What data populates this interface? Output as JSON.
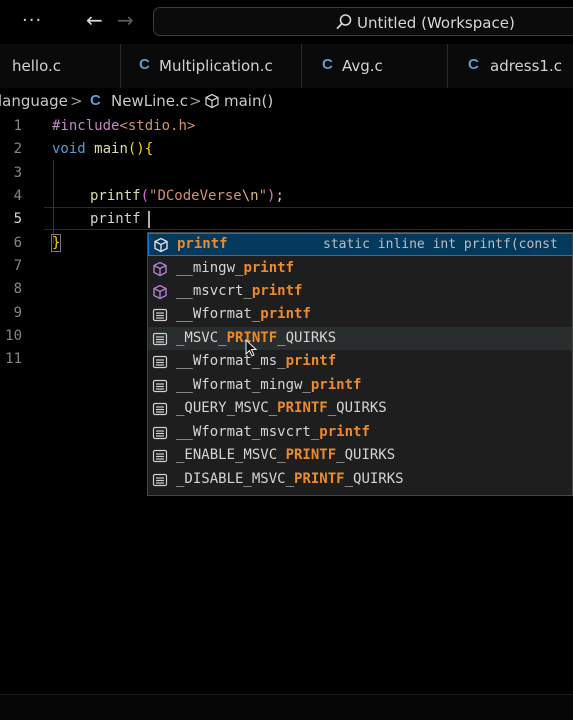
{
  "titlebar": {
    "menu_label": "···",
    "back_label": "←",
    "forward_label": "→",
    "search_title": "Untitled (Workspace)"
  },
  "tabs": [
    {
      "icon": "",
      "label": "hello.c"
    },
    {
      "icon": "C",
      "label": "Multiplication.c"
    },
    {
      "icon": "C",
      "label": "Avg.c"
    },
    {
      "icon": "C",
      "label": "adress1.c"
    }
  ],
  "breadcrumb": {
    "folder": "language",
    "sep1": ">",
    "file_icon": "C",
    "file": "NewLine.c",
    "sep2": ">",
    "symbol": "main()"
  },
  "editor": {
    "line_numbers": [
      "1",
      "2",
      "3",
      "4",
      "5",
      "6",
      "7",
      "8",
      "9",
      "10",
      "11"
    ],
    "active_line": "5",
    "lines": {
      "l1_include": "#include",
      "l1_header": "<stdio.h>",
      "l2_type": "void",
      "l2_fn": "main",
      "l2_parens": "()",
      "l2_brace": "{",
      "l4_fn": "printf",
      "l4_open": "(",
      "l4_str": "\"DCodeVerse",
      "l4_esc": "\\n",
      "l4_strend": "\"",
      "l4_close": ")",
      "l4_semi": ";",
      "l5_text": "printf",
      "l6_brace": "}"
    }
  },
  "suggestions": {
    "first_detail": "static inline int printf(const",
    "items": [
      {
        "icon": "cube-icon",
        "pre": "",
        "match": "printf",
        "post": ""
      },
      {
        "icon": "cube-purple-icon",
        "pre": "__mingw_",
        "match": "printf",
        "post": ""
      },
      {
        "icon": "cube-purple-icon",
        "pre": "__msvcrt_",
        "match": "printf",
        "post": ""
      },
      {
        "icon": "text-icon",
        "pre": "__Wformat_",
        "match": "printf",
        "post": ""
      },
      {
        "icon": "text-icon",
        "pre": "_MSVC_",
        "match": "PRINTF",
        "post": "_QUIRKS"
      },
      {
        "icon": "text-icon",
        "pre": "__Wformat_ms_",
        "match": "printf",
        "post": ""
      },
      {
        "icon": "text-icon",
        "pre": "__Wformat_mingw_",
        "match": "printf",
        "post": ""
      },
      {
        "icon": "text-icon",
        "pre": "_QUERY_MSVC_",
        "match": "PRINTF",
        "post": "_QUIRKS"
      },
      {
        "icon": "text-icon",
        "pre": "__Wformat_msvcrt_",
        "match": "printf",
        "post": ""
      },
      {
        "icon": "text-icon",
        "pre": "_ENABLE_MSVC_",
        "match": "PRINTF",
        "post": "_QUIRKS"
      },
      {
        "icon": "text-icon",
        "pre": "_DISABLE_MSVC_",
        "match": "PRINTF",
        "post": "_QUIRKS"
      }
    ]
  },
  "colors": {
    "accent": "#007fd4",
    "match_highlight": "#ec8b2c",
    "c_icon": "#5c9cd4"
  }
}
